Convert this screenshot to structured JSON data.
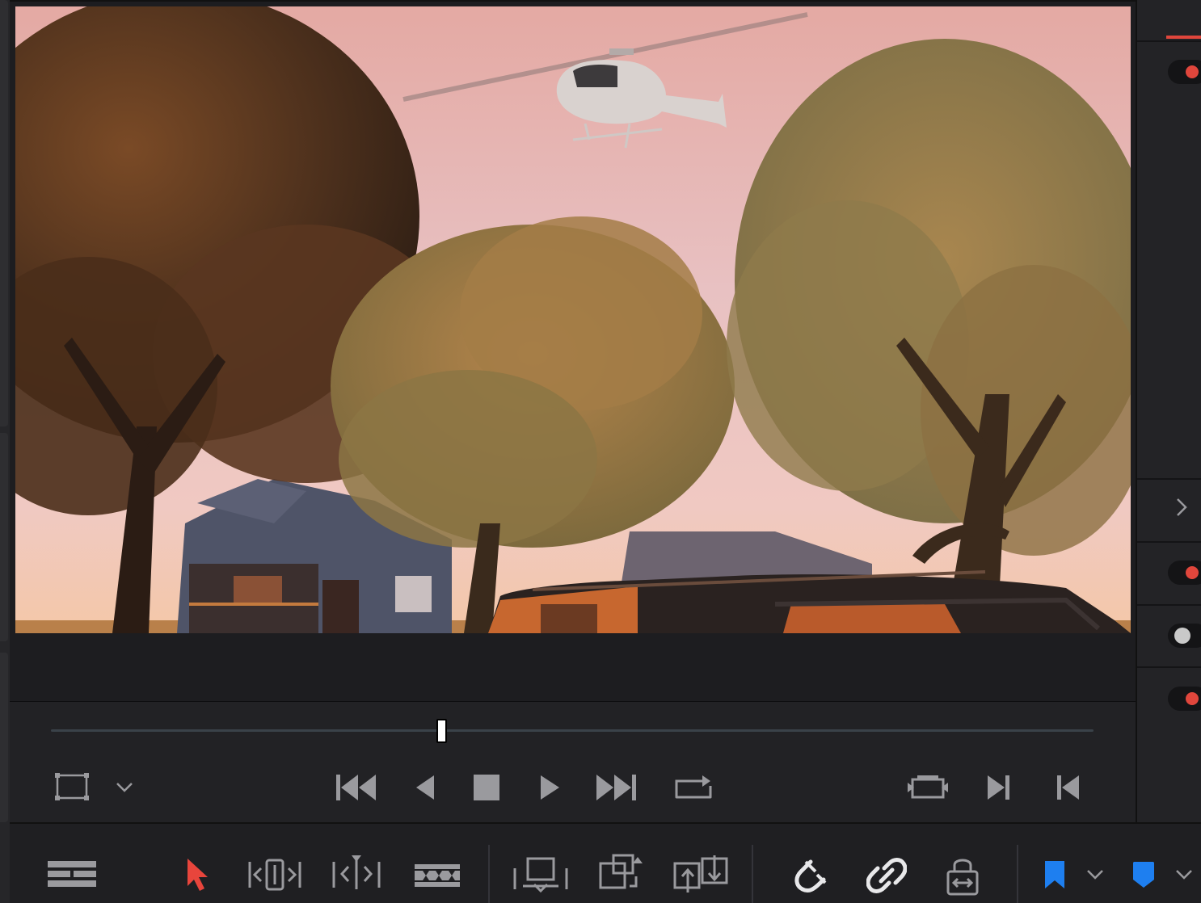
{
  "viewer": {
    "frame_scene": "sunset-helicopter-trees-house-car"
  },
  "scrubber": {
    "playhead_fraction": 0.375
  },
  "transport": {
    "buttons": [
      "viewer-crop-icon",
      "chevron-down-icon",
      "skip-to-start-icon",
      "reverse-play-icon",
      "stop-icon",
      "play-icon",
      "skip-to-end-icon",
      "loop-icon",
      "match-frame-icon",
      "next-edit-icon",
      "previous-edit-icon"
    ]
  },
  "toolbar": {
    "tools": [
      "timeline-view-icon",
      "selection-arrow-icon",
      "trim-edit-icon",
      "dynamic-trim-icon",
      "blade-icon",
      "insert-clip-icon",
      "overwrite-clip-icon",
      "replace-clip-icon",
      "snapping-icon",
      "linked-selection-icon",
      "position-lock-icon",
      "flag-icon",
      "chevron-down-icon",
      "marker-icon",
      "chevron-down-icon"
    ]
  },
  "colors": {
    "accent_red": "#e0463c",
    "selection_arrow": "#e8453c",
    "flag_blue": "#1e7ff0",
    "icon_grey": "#9a9a9e",
    "icon_white": "#e8e8ea"
  }
}
